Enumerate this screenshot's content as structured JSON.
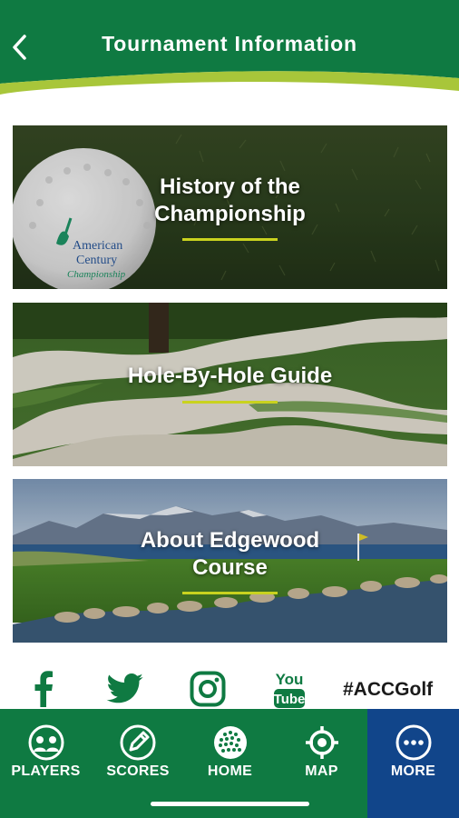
{
  "header": {
    "title": "Tournament Information"
  },
  "cards": [
    {
      "line1": "History of the",
      "line2": "Championship",
      "ball_text1": "American",
      "ball_text2": "Century",
      "ball_text3": "Championship"
    },
    {
      "line1": "Hole-By-Hole Guide"
    },
    {
      "line1": "About Edgewood",
      "line2": "Course"
    }
  ],
  "social": {
    "icons": [
      "facebook-icon",
      "twitter-icon",
      "instagram-icon",
      "youtube-icon"
    ],
    "youtube_top": "You",
    "youtube_bottom": "Tube",
    "hashtag": "#ACCGolf"
  },
  "tabs": [
    {
      "label": "PLAYERS",
      "icon": "players-icon"
    },
    {
      "label": "SCORES",
      "icon": "scores-icon"
    },
    {
      "label": "HOME",
      "icon": "golf-ball-icon"
    },
    {
      "label": "MAP",
      "icon": "map-target-icon"
    },
    {
      "label": "MORE",
      "icon": "more-icon",
      "active": true
    }
  ],
  "colors": {
    "brand_green": "#0f7a42",
    "accent_yellow": "#c9d21f",
    "active_tab_blue": "#11458a"
  }
}
